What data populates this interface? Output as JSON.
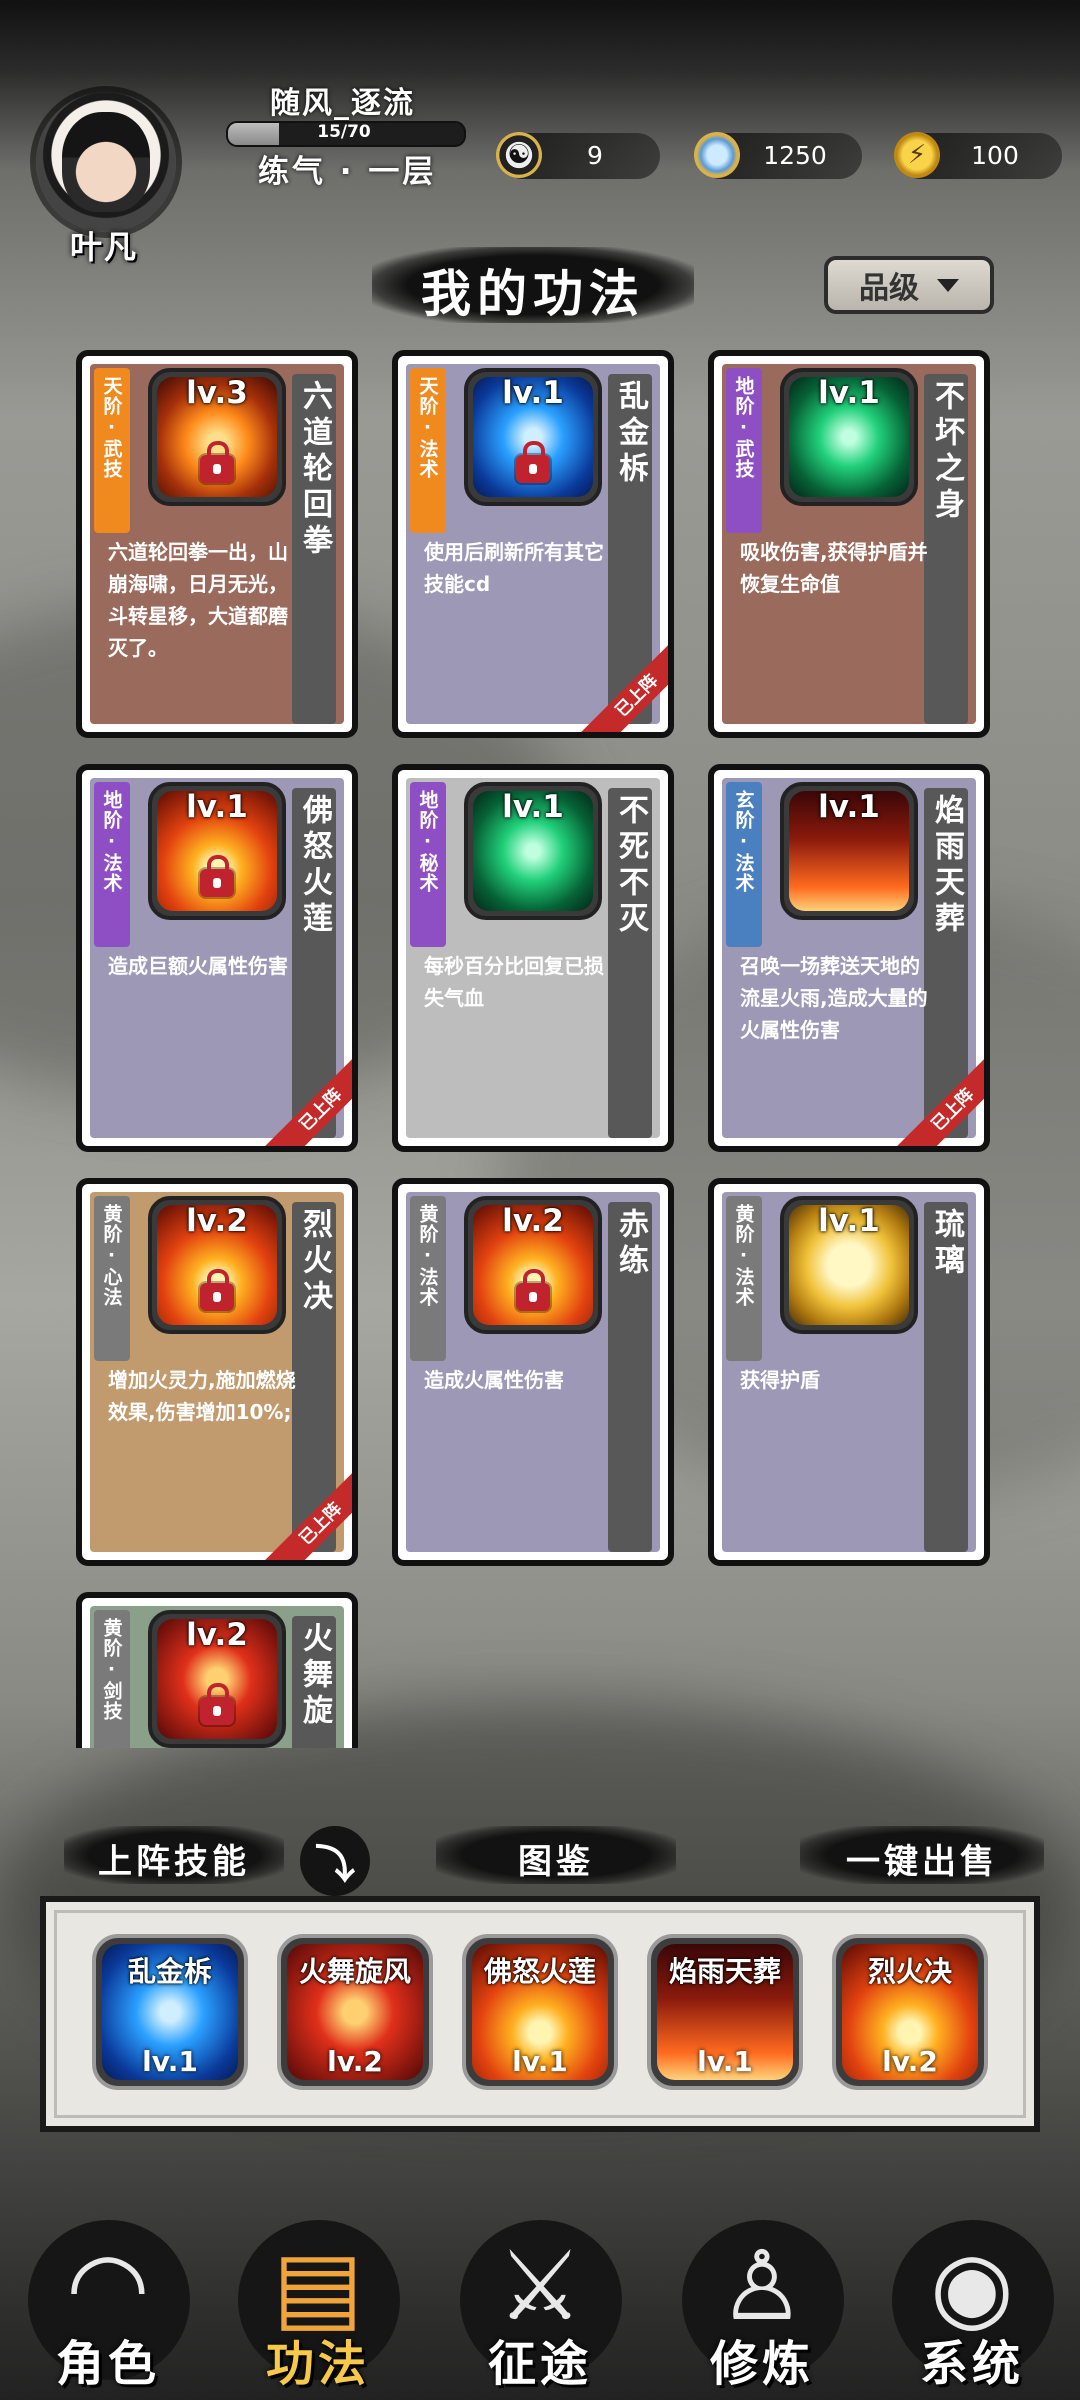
{
  "player": {
    "name": "叶凡",
    "username": "随风_逐流",
    "xp_text": "15/70",
    "xp_fraction": 0.214,
    "realm": "练气 · 一层"
  },
  "resources": [
    {
      "icon": "yin-yang-icon",
      "value": "9"
    },
    {
      "icon": "spirit-stone-icon",
      "value": "1250"
    },
    {
      "icon": "lightning-energy-icon",
      "value": "100"
    }
  ],
  "page_title": "我的功法",
  "sort_button": {
    "label": "品级",
    "icon": "caret-down-icon"
  },
  "equipped_ribbon": "已上阵",
  "skills": [
    {
      "grade": "天阶·武技",
      "grade_color": "#f0891e",
      "name": "六道轮回拳",
      "level": "lv.3",
      "locked": true,
      "art": "art-fist",
      "description": "六道轮回拳一出，山崩海啸，日月无光，斗转星移，大道都磨灭了。",
      "bg": "#9a6a5c",
      "equipped": false
    },
    {
      "grade": "天阶·法术",
      "grade_color": "#f0891e",
      "name": "乱金柝",
      "level": "lv.1",
      "locked": true,
      "art": "art-ice",
      "description": "使用后刷新所有其它技能cd",
      "bg": "#9c98b6",
      "equipped": true
    },
    {
      "grade": "地阶·武技",
      "grade_color": "#8e4ec4",
      "name": "不坏之身",
      "level": "lv.1",
      "locked": false,
      "art": "art-green",
      "description": "吸收伤害,获得护盾并恢复生命值",
      "bg": "#9a6a5c",
      "equipped": false
    },
    {
      "grade": "地阶·法术",
      "grade_color": "#8e4ec4",
      "name": "佛怒火莲",
      "level": "lv.1",
      "locked": true,
      "art": "art-fire",
      "description": "造成巨额火属性伤害",
      "bg": "#9c98b6",
      "equipped": true
    },
    {
      "grade": "地阶·秘术",
      "grade_color": "#8e4ec4",
      "name": "不死不灭",
      "level": "lv.1",
      "locked": false,
      "art": "art-green",
      "description": "每秒百分比回复已损失气血",
      "bg": "#bdbdbd",
      "equipped": false
    },
    {
      "grade": "玄阶·法术",
      "grade_color": "#4a7fc0",
      "name": "焰雨天葬",
      "level": "lv.1",
      "locked": false,
      "art": "art-rain",
      "description": "召唤一场葬送天地的流星火雨,造成大量的火属性伤害",
      "bg": "#9c98b6",
      "equipped": true
    },
    {
      "grade": "黄阶·心法",
      "grade_color": "#7a7a7a",
      "name": "烈火决",
      "level": "lv.2",
      "locked": true,
      "art": "art-fire",
      "description": "增加火灵力,施加燃烧效果,伤害增加10%;",
      "bg": "#c19a6e",
      "equipped": true
    },
    {
      "grade": "黄阶·法术",
      "grade_color": "#7a7a7a",
      "name": "赤练",
      "level": "lv.2",
      "locked": true,
      "art": "art-fire",
      "description": "造成火属性伤害",
      "bg": "#9c98b6",
      "equipped": false
    },
    {
      "grade": "黄阶·法术",
      "grade_color": "#7a7a7a",
      "name": "琉璃",
      "level": "lv.1",
      "locked": false,
      "art": "art-shield",
      "description": "获得护盾",
      "bg": "#9c98b6",
      "equipped": false
    },
    {
      "grade": "黄阶·剑技",
      "grade_color": "#7a7a7a",
      "name": "火舞旋",
      "level": "lv.2",
      "locked": true,
      "art": "art-fireblade",
      "description": "",
      "bg": "#8aa08a",
      "equipped": false
    }
  ],
  "sections": {
    "equipped_label": "上阵技能",
    "collapse_icon": "arrow-down-icon",
    "codex_label": "图鉴",
    "sell_all_label": "一键出售"
  },
  "equipped_slots": [
    {
      "name": "乱金柝",
      "level": "lv.1",
      "art": "art-ice"
    },
    {
      "name": "火舞旋风",
      "level": "lv.2",
      "art": "art-fireblade"
    },
    {
      "name": "佛怒火莲",
      "level": "lv.1",
      "art": "art-fire"
    },
    {
      "name": "焰雨天葬",
      "level": "lv.1",
      "art": "art-rain"
    },
    {
      "name": "烈火决",
      "level": "lv.2",
      "art": "art-fire"
    }
  ],
  "nav": [
    {
      "label": "角色",
      "icon": "character-icon",
      "active": false
    },
    {
      "label": "功法",
      "icon": "skill-book-icon",
      "active": true
    },
    {
      "label": "征途",
      "icon": "journey-sword-icon",
      "active": false
    },
    {
      "label": "修炼",
      "icon": "meditation-icon",
      "active": false
    },
    {
      "label": "系统",
      "icon": "system-icon",
      "active": false
    }
  ]
}
